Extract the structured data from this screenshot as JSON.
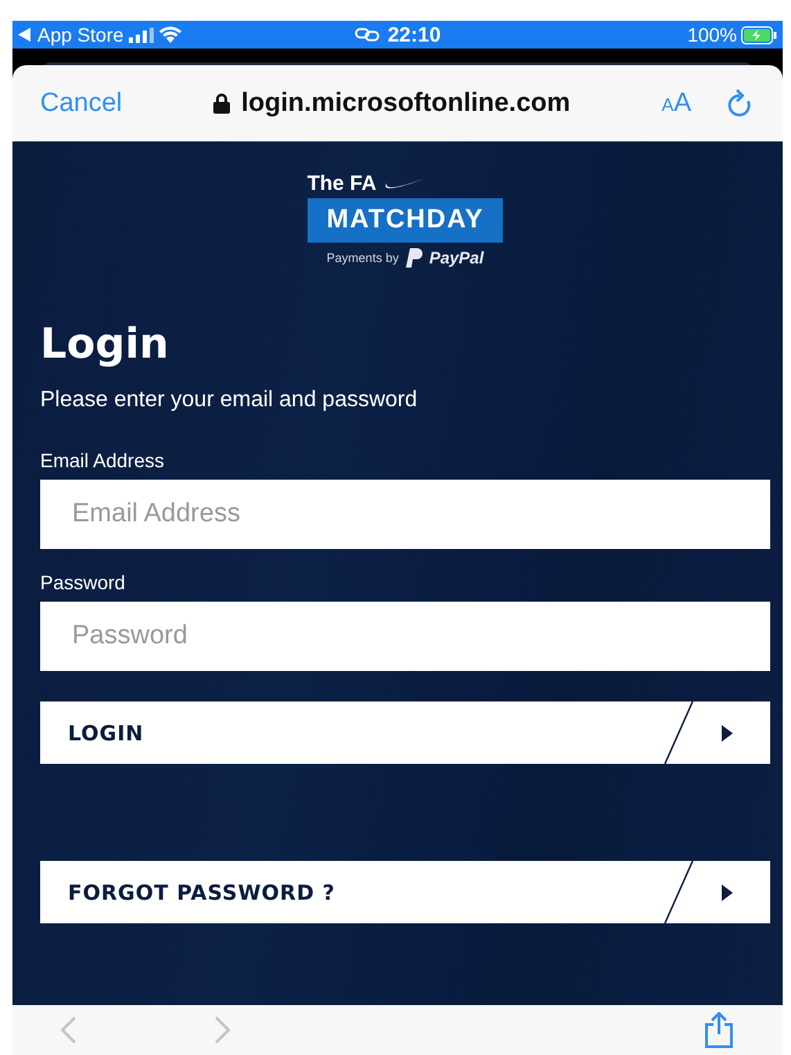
{
  "status_bar": {
    "back_app": "App Store",
    "time": "22:10",
    "battery": "100%"
  },
  "browser_bar": {
    "cancel": "Cancel",
    "url": "login.microsoftonline.com",
    "text_size": "AA"
  },
  "logo": {
    "brand": "The FA",
    "title": "MATCHDAY",
    "payments": "Payments by",
    "paypal": "PayPal"
  },
  "heading": "Login",
  "intro": "Please enter your email and password",
  "fields": [
    {
      "label": "Email Address",
      "placeholder": "Email Address"
    },
    {
      "label": "Password",
      "placeholder": "Password"
    }
  ],
  "buttons": [
    {
      "label": "LOGIN"
    },
    {
      "label": "FORGOT PASSWORD ?"
    }
  ],
  "toolbar": {
    "back_disabled": true,
    "forward_disabled": true
  }
}
